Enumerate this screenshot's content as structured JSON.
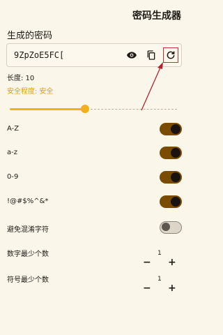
{
  "header": {
    "title": "密码生成器"
  },
  "generated": {
    "section_label": "生成的密码",
    "password": "9ZpZoE5FC[",
    "length_text": "长度: 10",
    "safety_text": "安全程度: 安全"
  },
  "slider": {
    "value_fraction": 0.45
  },
  "options": [
    {
      "label": "A-Z",
      "enabled": true
    },
    {
      "label": "a-z",
      "enabled": true
    },
    {
      "label": "0-9",
      "enabled": true
    },
    {
      "label": "!@#$%^&*",
      "enabled": true
    },
    {
      "label": "避免混淆字符",
      "enabled": false
    }
  ],
  "steppers": [
    {
      "label": "数字最少个数",
      "value": "1",
      "minus": "−",
      "plus": "+"
    },
    {
      "label": "符号最少个数",
      "value": "1",
      "minus": "−",
      "plus": "+"
    }
  ],
  "colors": {
    "accent": "#f2b01c",
    "toggle_on": "#7a4c00",
    "annotation": "#b0262e"
  },
  "icons": [
    "eye-icon",
    "copy-icon",
    "refresh-icon"
  ]
}
